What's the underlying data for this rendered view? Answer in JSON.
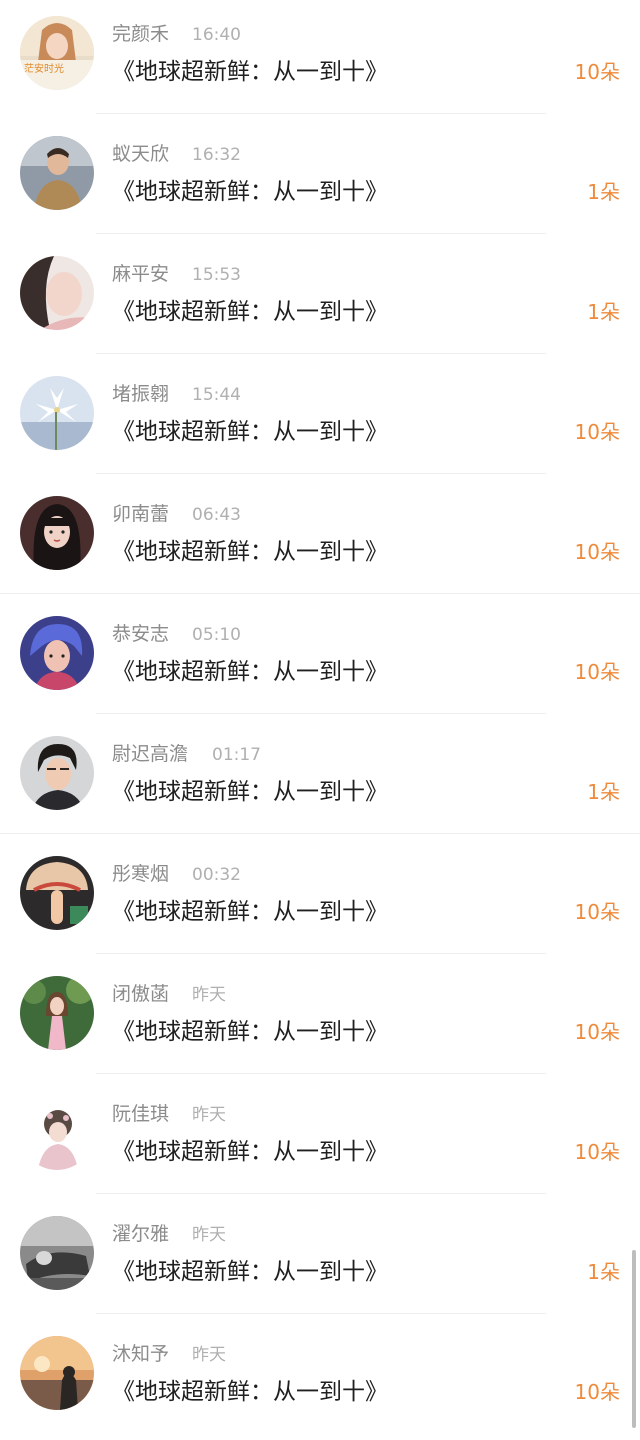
{
  "rows": [
    {
      "name": "完颜禾",
      "time": "16:40",
      "title": "《地球超新鲜：从一到十》",
      "count": "10朵",
      "avatar_text": "茫安时光"
    },
    {
      "name": "蚁天欣",
      "time": "16:32",
      "title": "《地球超新鲜：从一到十》",
      "count": "1朵"
    },
    {
      "name": "麻平安",
      "time": "15:53",
      "title": "《地球超新鲜：从一到十》",
      "count": "1朵"
    },
    {
      "name": "堵振翱",
      "time": "15:44",
      "title": "《地球超新鲜：从一到十》",
      "count": "10朵"
    },
    {
      "name": "卯南蕾",
      "time": "06:43",
      "title": "《地球超新鲜：从一到十》",
      "count": "10朵"
    },
    {
      "name": "恭安志",
      "time": "05:10",
      "title": "《地球超新鲜：从一到十》",
      "count": "10朵"
    },
    {
      "name": "尉迟高澹",
      "time": "01:17",
      "title": "《地球超新鲜：从一到十》",
      "count": "1朵"
    },
    {
      "name": "彤寒烟",
      "time": "00:32",
      "title": "《地球超新鲜：从一到十》",
      "count": "10朵"
    },
    {
      "name": "闭傲菡",
      "time": "昨天",
      "title": "《地球超新鲜：从一到十》",
      "count": "10朵"
    },
    {
      "name": "阮佳琪",
      "time": "昨天",
      "title": "《地球超新鲜：从一到十》",
      "count": "10朵"
    },
    {
      "name": "濯尔雅",
      "time": "昨天",
      "title": "《地球超新鲜：从一到十》",
      "count": "1朵"
    },
    {
      "name": "沐知予",
      "time": "昨天",
      "title": "《地球超新鲜：从一到十》",
      "count": "10朵"
    }
  ],
  "colors": {
    "count": "#ee8a3c",
    "name": "#8c8c8c",
    "time": "#b0b0b0",
    "title": "#1f1f1f"
  }
}
